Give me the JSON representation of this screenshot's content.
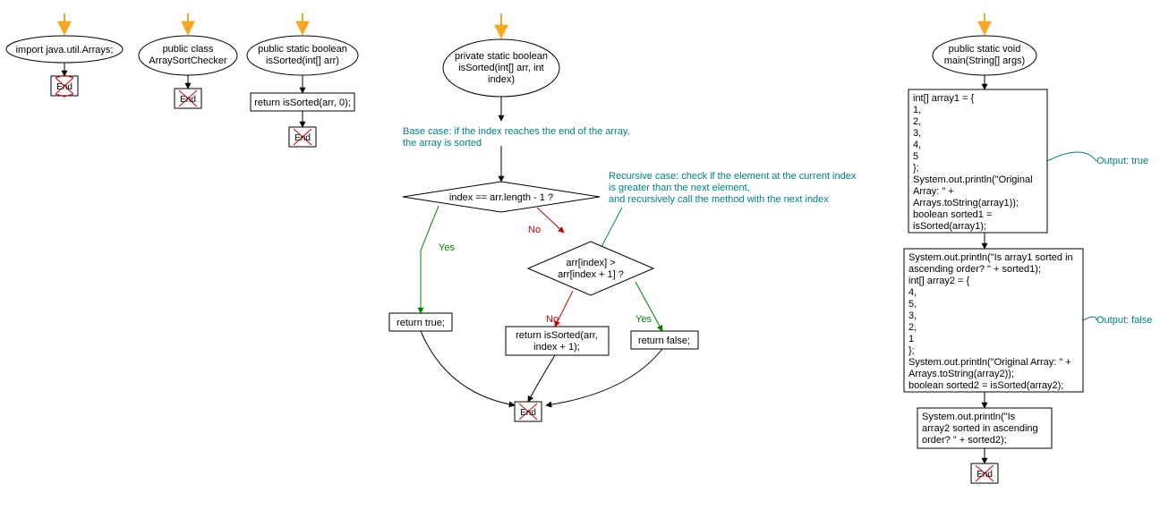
{
  "chart_data": {
    "type": "diagram",
    "flows": [
      {
        "start_label": "import java.util.Arrays;",
        "end": "End"
      },
      {
        "start_label": "public class ArraySortChecker",
        "end": "End"
      },
      {
        "start_label": "public static boolean isSorted(int[] arr)",
        "step1": "return isSorted(arr, 0);",
        "end": "End"
      },
      {
        "start_label": "private static boolean isSorted(int[] arr, int index)",
        "comment1": [
          "Base case: if the index reaches the end of the array,",
          "the array is sorted"
        ],
        "decision1": "index == arr.length - 1 ?",
        "decision1_yes": "return true;",
        "comment2": [
          "Recursive case: check if the element at the current index",
          "is greater than the next element,",
          "and recursively call the method with the next index"
        ],
        "decision2": "arr[index] > arr[index + 1] ?",
        "decision2_yes": "return false;",
        "decision2_no": "return isSorted(arr, index + 1);",
        "end": "End"
      },
      {
        "start_label": "public static void main(String[] args)",
        "block1": [
          "int[] array1 = {",
          "1,",
          "2,",
          "3,",
          "4,",
          "5",
          "};",
          "System.out.println(\"Original",
          "Array: \" +",
          "Arrays.toString(array1));",
          "boolean sorted1 =",
          "isSorted(array1);"
        ],
        "comment1": "Output: true",
        "block2": [
          "System.out.println(\"Is array1 sorted in",
          "ascending order? \" + sorted1);",
          "int[] array2 = {",
          "4,",
          "5,",
          "3,",
          "2,",
          "1",
          "};",
          "System.out.println(\"Original Array: \" +",
          "Arrays.toString(array2));",
          "boolean sorted2 = isSorted(array2);"
        ],
        "comment2": "Output: false",
        "block3": [
          "System.out.println(\"Is",
          "array2 sorted in ascending",
          "order? \" + sorted2);"
        ],
        "end": "End"
      }
    ]
  },
  "labels": {
    "end": "End",
    "yes": "Yes",
    "no": "No"
  },
  "n1": {
    "title": "import java.util.Arrays;"
  },
  "n2": {
    "title": "public class",
    "title2": "ArraySortChecker"
  },
  "n3": {
    "title": "public static boolean",
    "title2": "isSorted(int[] arr)",
    "step": "return isSorted(arr, 0);"
  },
  "n4": {
    "title": "private static boolean",
    "title2": "isSorted(int[] arr, int",
    "title3": "index)",
    "c1a": "Base case: if the index reaches the end of the array,",
    "c1b": "the array is sorted",
    "d1": "index == arr.length - 1 ?",
    "ret_true": "return true;",
    "c2a": "Recursive case: check if the element at the current index",
    "c2b": "is greater than the next element,",
    "c2c": "and recursively call the method with the next index",
    "d2a": "arr[index] >",
    "d2b": "arr[index + 1] ?",
    "ret_false": "return false;",
    "ret_rec1": "return isSorted(arr,",
    "ret_rec2": "index + 1);"
  },
  "n5": {
    "title": "public static void",
    "title2": "main(String[] args)",
    "b1_0": "int[] array1 = {",
    "b1_1": "1,",
    "b1_2": "2,",
    "b1_3": "3,",
    "b1_4": "4,",
    "b1_5": "5",
    "b1_6": "};",
    "b1_7": "System.out.println(\"Original",
    "b1_8": "Array: \" +",
    "b1_9": "Arrays.toString(array1));",
    "b1_10": "boolean sorted1 =",
    "b1_11": "isSorted(array1);",
    "cm1": "Output: true",
    "b2_0": "System.out.println(\"Is array1 sorted in",
    "b2_1": "ascending order? \" + sorted1);",
    "b2_2": "int[] array2 = {",
    "b2_3": "4,",
    "b2_4": "5,",
    "b2_5": "3,",
    "b2_6": "2,",
    "b2_7": "1",
    "b2_8": "};",
    "b2_9": "System.out.println(\"Original Array: \" +",
    "b2_10": "Arrays.toString(array2));",
    "b2_11": "boolean sorted2 = isSorted(array2);",
    "cm2": "Output: false",
    "b3_0": "System.out.println(\"Is",
    "b3_1": "array2 sorted in ascending",
    "b3_2": "order? \" + sorted2);"
  }
}
